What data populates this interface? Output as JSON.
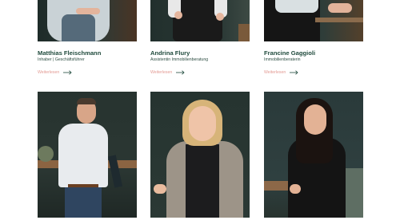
{
  "team": {
    "members": [
      {
        "name": "Matthias Fleischmann",
        "role": "Inhaber | Geschäftsführer",
        "link": "Weiterlesen"
      },
      {
        "name": "Andrina Flury",
        "role": "Assistentin Immobilienberatung",
        "link": "Weiterlesen"
      },
      {
        "name": "Francine Gaggioli",
        "role": "Immobilienberaterin",
        "link": "Weiterlesen"
      }
    ]
  },
  "colors": {
    "name_text": "#1f4a3c",
    "link_text": "#e39a93",
    "photo_background": "#243330"
  },
  "icons": {
    "read_more": "arrow-right-icon"
  }
}
